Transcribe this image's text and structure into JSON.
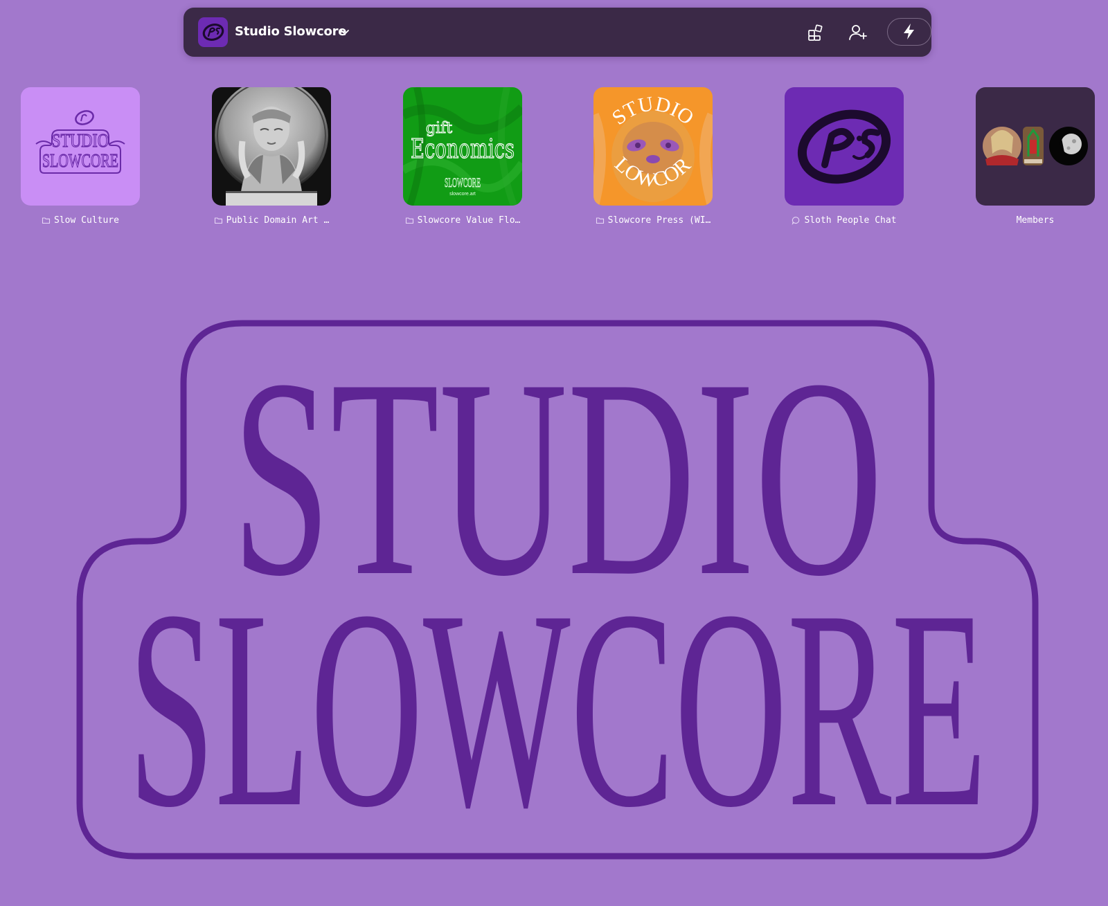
{
  "header": {
    "space_name": "Studio Slowcore"
  },
  "tiles": [
    {
      "label": "Slow Culture",
      "type": "folder",
      "thumb_lines": [
        "STUDIO",
        "SLOWCORE"
      ]
    },
    {
      "label": "Public Domain Art …",
      "type": "folder"
    },
    {
      "label": "Slowcore Value Flo…",
      "type": "folder",
      "thumb_lines": [
        "gift",
        "Economics",
        "SLOWCORE",
        "slowcore.art"
      ]
    },
    {
      "label": "Slowcore Press (WI…",
      "type": "folder",
      "thumb_lines": [
        "STUDIO",
        "SLOWCORE"
      ]
    },
    {
      "label": "Sloth People Chat",
      "type": "chat"
    },
    {
      "label": "Members",
      "type": "members"
    }
  ],
  "hero": {
    "line1": "STUDIO",
    "line2": "SLOWCORE"
  },
  "colors": {
    "background": "#a278cc",
    "topbar": "#3b2947",
    "accent_purple": "#5e2594",
    "tile_lilac": "#c98ef5",
    "tile_green": "#119c15",
    "tile_orange": "#f5962a",
    "tile_violet": "#6d2bb3",
    "tile_dark": "#3b2947"
  }
}
